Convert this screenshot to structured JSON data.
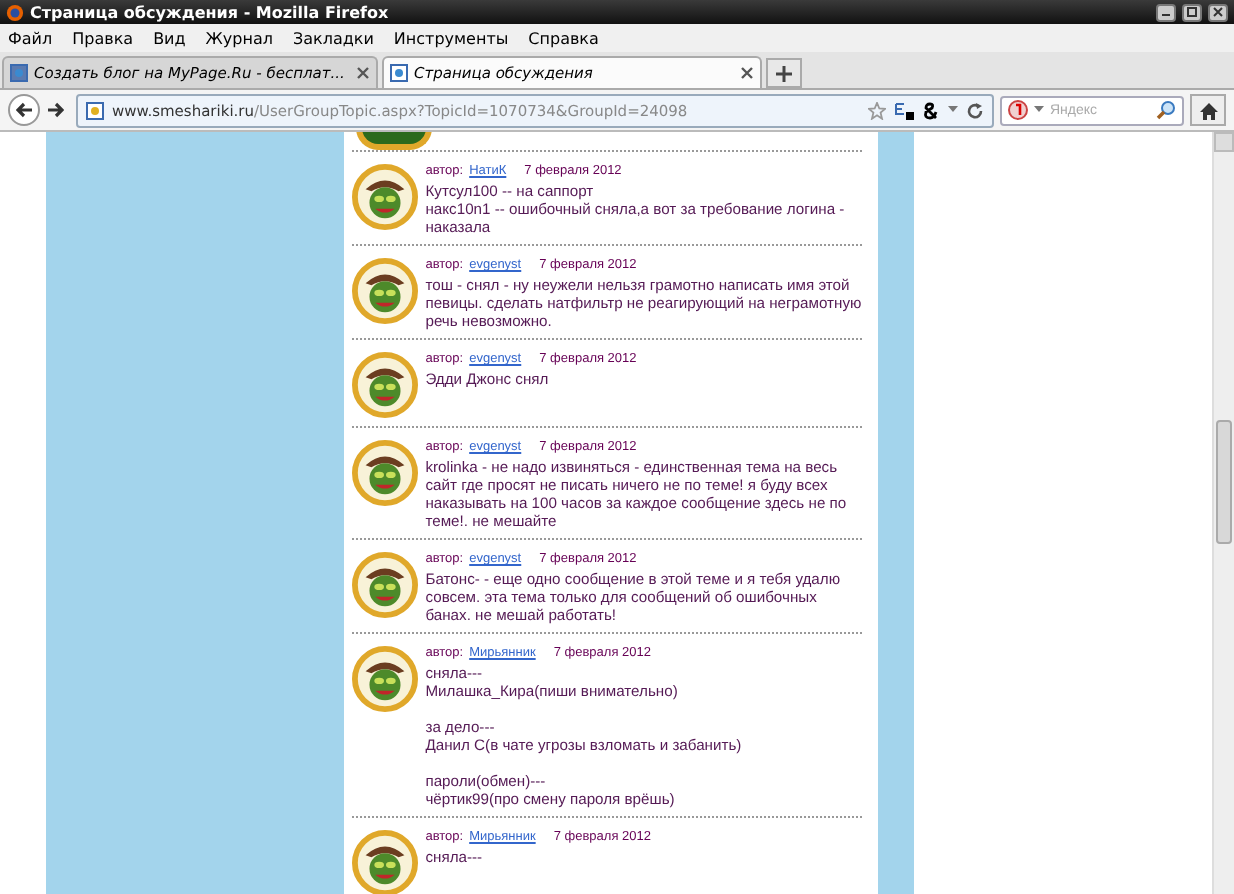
{
  "window": {
    "title": "Страница обсуждения - Mozilla Firefox"
  },
  "menu": [
    "Файл",
    "Правка",
    "Вид",
    "Журнал",
    "Закладки",
    "Инструменты",
    "Справка"
  ],
  "tabs": [
    {
      "label": "Создать блог на MyPage.Ru - бесплат...",
      "selected": false
    },
    {
      "label": "Страница обсуждения",
      "selected": true
    }
  ],
  "address": {
    "domain": "www.smeshariki.ru",
    "path": "/UserGroupTopic.aspx?TopicId=1070734&GroupId=24098"
  },
  "search": {
    "placeholder": "Яндекс"
  },
  "posts": [
    {
      "author_label": "автор:",
      "author": "НатиК",
      "date": "7 февраля 2012",
      "text": "Кутсул100 -- на саппорт\nнакс10n1 -- ошибочный сняла,а вот за требование логина - наказала"
    },
    {
      "author_label": "автор:",
      "author": "evgenyst",
      "date": "7 февраля 2012",
      "text": "тош - снял - ну неужели нельзя грамотно написать имя этой певицы. сделать натфильтр не реагирующий на неграмотную речь невозможно."
    },
    {
      "author_label": "автор:",
      "author": "evgenyst",
      "date": "7 февраля 2012",
      "text": "Эдди Джонс снял"
    },
    {
      "author_label": "автор:",
      "author": "evgenyst",
      "date": "7 февраля 2012",
      "text": "krolinka - не надо извиняться - единственная тема на весь сайт где просят не писать ничего не по теме! я буду всех наказывать на 100 часов за каждое сообщение здесь не по теме!. не мешайте"
    },
    {
      "author_label": "автор:",
      "author": "evgenyst",
      "date": "7 февраля 2012",
      "text": "Батонс- - еще одно сообщение в этой теме и я тебя удалю совсем. эта тема только для сообщений об ошибочных банах. не мешай работать!"
    },
    {
      "author_label": "автор:",
      "author": "Мирьянник",
      "date": "7 февраля 2012",
      "text": "сняла---\nМилашка_Кира(пиши внимательно)\n\nза дело---\nДанил С(в чате угрозы взломать и забанить)\n\nпароли(обмен)---\nчёртик99(про смену пароля врёшь)"
    },
    {
      "author_label": "автор:",
      "author": "Мирьянник",
      "date": "7 февраля 2012",
      "text": "сняла---"
    }
  ]
}
